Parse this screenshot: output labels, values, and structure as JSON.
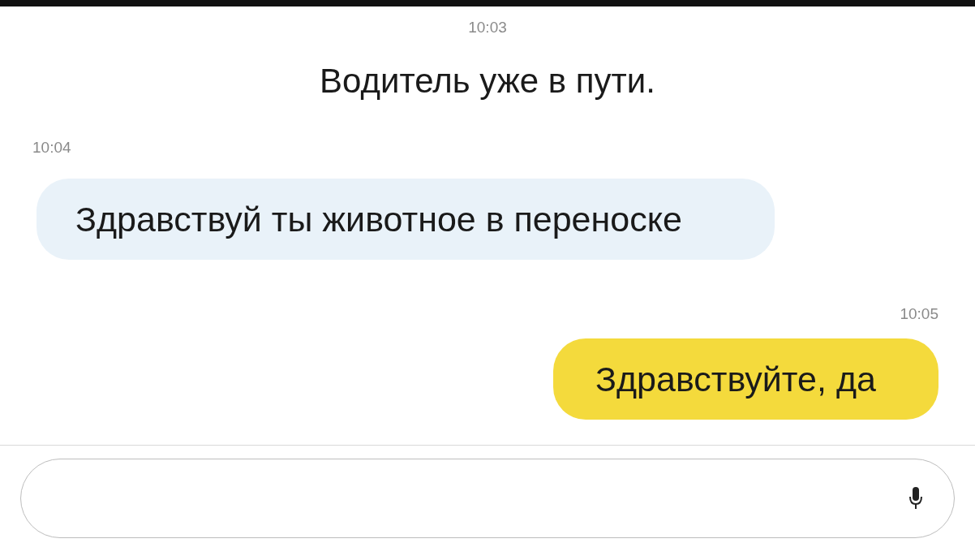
{
  "messages": [
    {
      "kind": "time",
      "text": "10:03"
    },
    {
      "kind": "system",
      "text": "Водитель уже в пути."
    },
    {
      "kind": "time",
      "text": "10:04"
    },
    {
      "kind": "incoming",
      "text": "Здравствуй ты животное в переноске"
    },
    {
      "kind": "time",
      "text": "10:05"
    },
    {
      "kind": "outgoing",
      "text": "Здравствуйте, да"
    }
  ]
}
